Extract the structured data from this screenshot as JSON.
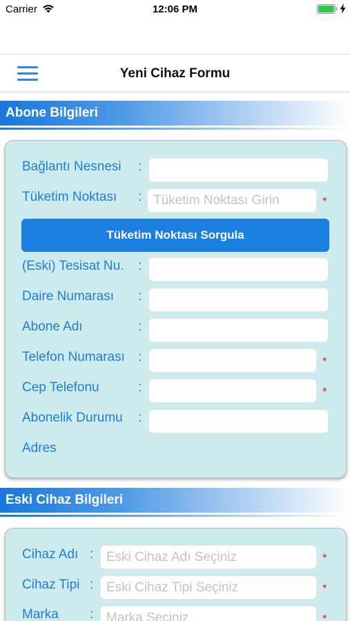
{
  "status_bar": {
    "carrier": "Carrier",
    "time": "12:06 PM",
    "icons": [
      "wifi-icon",
      "battery-icon",
      "charging-bolt-icon"
    ]
  },
  "nav": {
    "title": "Yeni Cihaz Formu",
    "menu_icon": "hamburger-menu-icon"
  },
  "subscriber_section": {
    "title": "Abone Bilgileri",
    "fields": {
      "connection_object": {
        "label": "Bağlantı Nesnesi",
        "value": ""
      },
      "consumption_point": {
        "label": "Tüketim Noktası",
        "placeholder": "Tüketim Noktası Girin",
        "required_mark": "*"
      },
      "query_button": "Tüketim Noktası Sorgula",
      "installation_no": {
        "label": "(Eski) Tesisat Nu.",
        "value": ""
      },
      "apartment_no": {
        "label": "Daire Numarası",
        "value": ""
      },
      "subscriber_name": {
        "label": "Abone Adı",
        "value": ""
      },
      "phone": {
        "label": "Telefon Numarası",
        "value": "",
        "required_mark": "*"
      },
      "mobile": {
        "label": "Cep Telefonu",
        "value": "",
        "required_mark": "*"
      },
      "subscription_status": {
        "label": "Abonelik Durumu",
        "value": ""
      },
      "address": {
        "label": "Adres"
      }
    },
    "colon": ":"
  },
  "old_device_section": {
    "title": "Eski Cihaz Bilgileri",
    "fields": {
      "device_name": {
        "label": "Cihaz Adı",
        "placeholder": "Eski Cihaz Adı Seçiniz",
        "required_mark": "*"
      },
      "device_type": {
        "label": "Cihaz Tipi",
        "placeholder": "Eski Cihaz Tipi Seçiniz",
        "required_mark": "*"
      },
      "brand": {
        "label": "Marka",
        "placeholder": "Marka Seçiniz",
        "required_mark": "*"
      }
    },
    "colon": ":"
  },
  "colors": {
    "accent": "#1A7FE0",
    "label": "#1F7ED8",
    "card_bg": "#CDEAEC",
    "required": "#E02020"
  }
}
